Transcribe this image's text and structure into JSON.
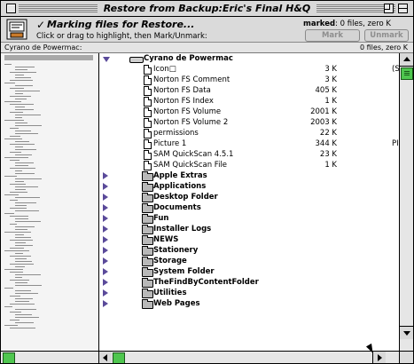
{
  "window": {
    "title": "Restore from Backup:Eric's Final H&Q"
  },
  "header": {
    "check_glyph": "✓",
    "mode_title": "Marking files for Restore...",
    "mode_help": "Click or drag to highlight, then Mark/Unmark:",
    "marked_label": "marked",
    "marked_value": ": 0 files, zero K",
    "mark_button": "Mark",
    "unmark_button": "Unmark"
  },
  "pathbar": {
    "volume": "Cyrano de Powermac:",
    "summary": "0 files, zero K"
  },
  "list": {
    "root": {
      "name": "Cyrano de Powermac"
    },
    "files": [
      {
        "name": "Icon□",
        "size": "3 K",
        "extra": "(S"
      },
      {
        "name": "Norton FS Comment",
        "size": "3 K",
        "extra": ""
      },
      {
        "name": "Norton FS Data",
        "size": "405 K",
        "extra": ""
      },
      {
        "name": "Norton FS Index",
        "size": "1 K",
        "extra": ""
      },
      {
        "name": "Norton FS Volume",
        "size": "2001 K",
        "extra": ""
      },
      {
        "name": "Norton FS Volume 2",
        "size": "2003 K",
        "extra": ""
      },
      {
        "name": "permissions",
        "size": "22 K",
        "extra": ""
      },
      {
        "name": "Picture 1",
        "size": "344 K",
        "extra": "PI"
      },
      {
        "name": "SAM QuickScan 4.5.1",
        "size": "23 K",
        "extra": ""
      },
      {
        "name": "SAM QuickScan File",
        "size": "1 K",
        "extra": ""
      }
    ],
    "folders": [
      {
        "name": "Apple Extras"
      },
      {
        "name": "Applications"
      },
      {
        "name": "Desktop Folder"
      },
      {
        "name": "Documents"
      },
      {
        "name": "Fun"
      },
      {
        "name": "Installer Logs"
      },
      {
        "name": "NEWS"
      },
      {
        "name": "Stationery"
      },
      {
        "name": "Storage"
      },
      {
        "name": "System Folder"
      },
      {
        "name": "TheFindByContentFolder"
      },
      {
        "name": "Utilities"
      },
      {
        "name": "Web Pages"
      }
    ]
  },
  "colors": {
    "scroll_thumb": "#4fc64f",
    "triangle": "#5a4a9a"
  },
  "icons": {
    "close": "close-box-icon",
    "zoom": "zoom-box-icon",
    "collapse": "collapse-box-icon",
    "mode": "restore-mode-icon",
    "disk": "disk-icon",
    "file": "document-icon",
    "folder": "folder-icon"
  }
}
